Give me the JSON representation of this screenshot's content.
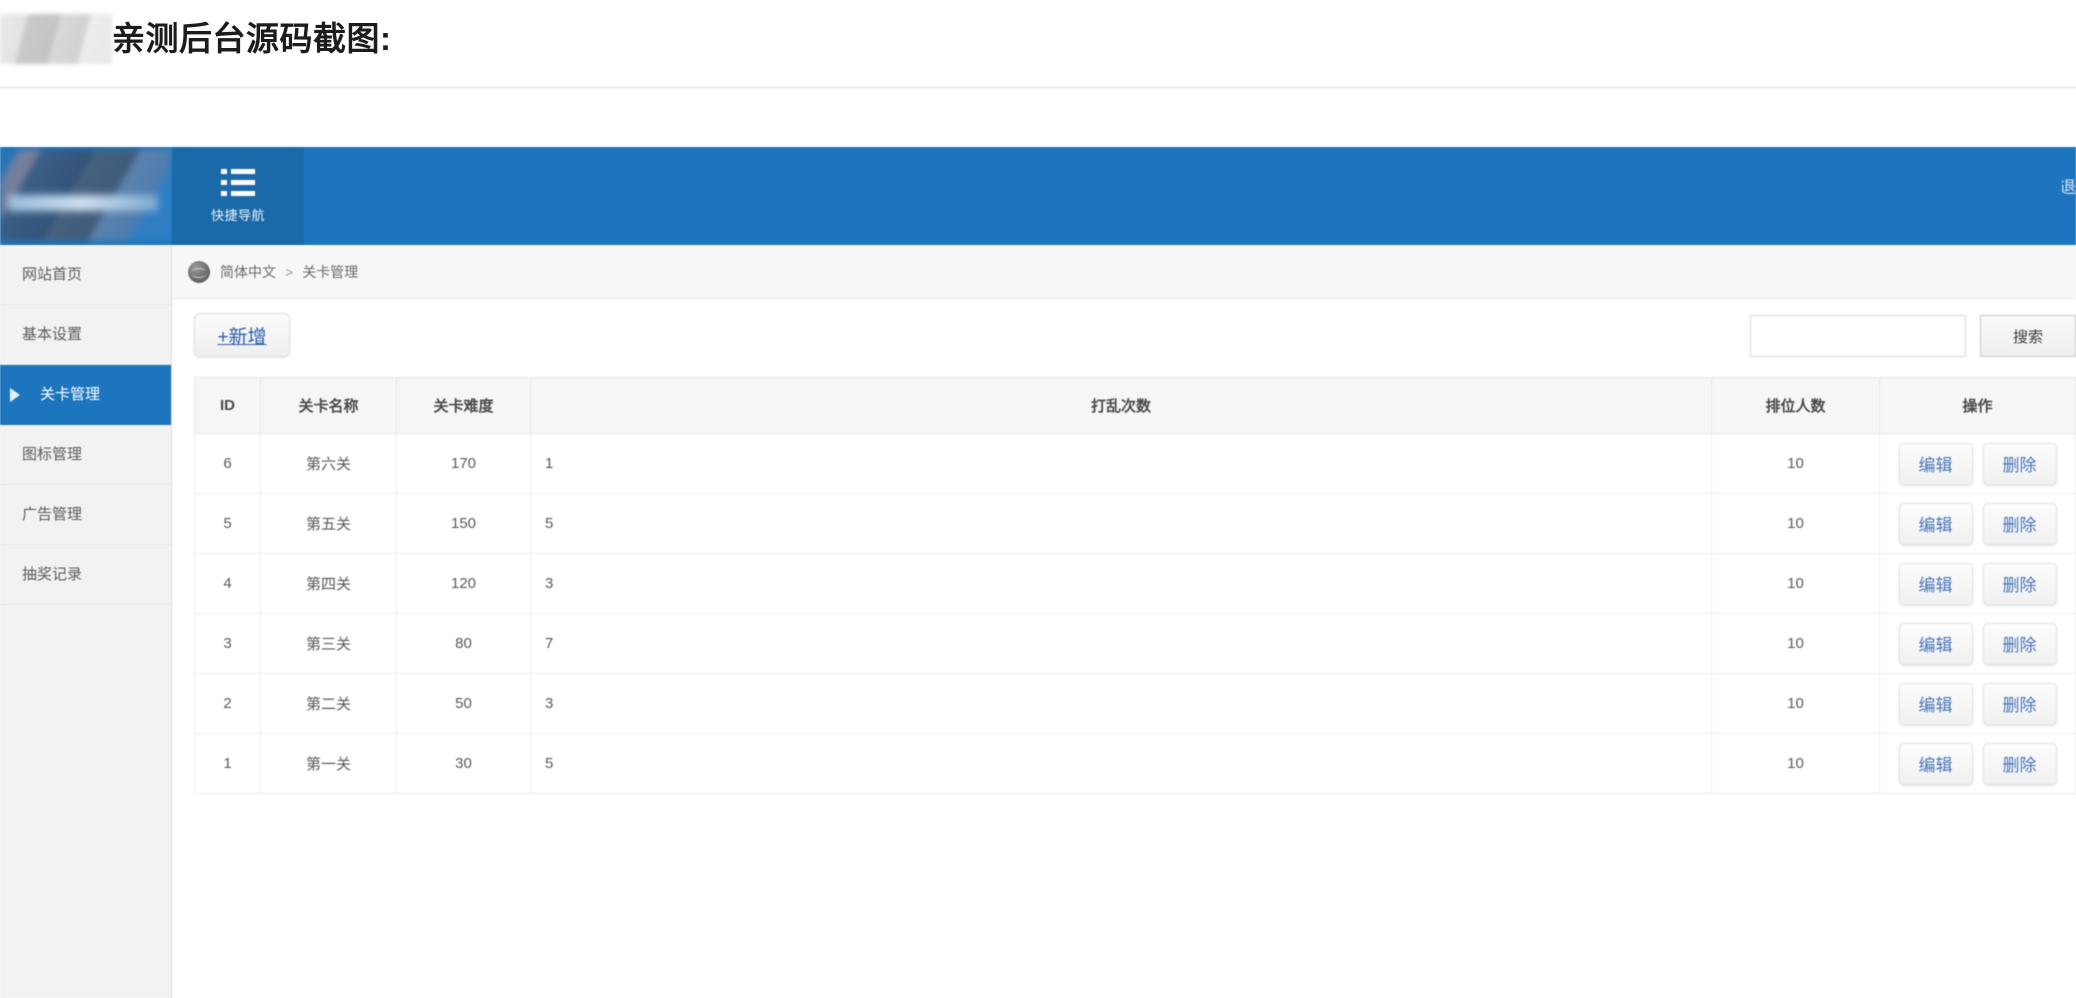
{
  "caption": {
    "redaction_label": "redacted-block",
    "text": "亲测后台源码截图:"
  },
  "topbar": {
    "logo_label": "redacted-logo",
    "quick_nav": {
      "icon": "list-icon",
      "label": "快捷导航"
    },
    "right_partial": "退"
  },
  "sidebar": {
    "items": [
      {
        "label": "网站首页",
        "active": false
      },
      {
        "label": "基本设置",
        "active": false
      },
      {
        "label": "关卡管理",
        "active": true
      },
      {
        "label": "图标管理",
        "active": false
      },
      {
        "label": "广告管理",
        "active": false
      },
      {
        "label": "抽奖记录",
        "active": false
      }
    ]
  },
  "breadcrumb": {
    "icon": "globe-icon",
    "root": "简体中文",
    "separator": ">",
    "current": "关卡管理"
  },
  "toolbar": {
    "add_label": "+新增",
    "search_value": "",
    "search_placeholder": "",
    "search_button_label": "搜索"
  },
  "table": {
    "columns": [
      "ID",
      "关卡名称",
      "关卡难度",
      "打乱次数",
      "排位人数",
      "操作"
    ],
    "rows": [
      {
        "id": "6",
        "name": "第六关",
        "difficulty": "170",
        "shuffle": "1",
        "rank": "10",
        "edit": "编辑",
        "delete": "删除"
      },
      {
        "id": "5",
        "name": "第五关",
        "difficulty": "150",
        "shuffle": "5",
        "rank": "10",
        "edit": "编辑",
        "delete": "删除"
      },
      {
        "id": "4",
        "name": "第四关",
        "difficulty": "120",
        "shuffle": "3",
        "rank": "10",
        "edit": "编辑",
        "delete": "删除"
      },
      {
        "id": "3",
        "name": "第三关",
        "difficulty": "80",
        "shuffle": "7",
        "rank": "10",
        "edit": "编辑",
        "delete": "删除"
      },
      {
        "id": "2",
        "name": "第二关",
        "difficulty": "50",
        "shuffle": "3",
        "rank": "10",
        "edit": "编辑",
        "delete": "删除"
      },
      {
        "id": "1",
        "name": "第一关",
        "difficulty": "30",
        "shuffle": "5",
        "rank": "10",
        "edit": "编辑",
        "delete": "删除"
      }
    ]
  },
  "colors": {
    "brand_blue": "#1d76bd",
    "nav_blue_dark": "#1a6aaa",
    "sidebar_bg": "#f2f2f2",
    "link_blue": "#4a76b8"
  }
}
